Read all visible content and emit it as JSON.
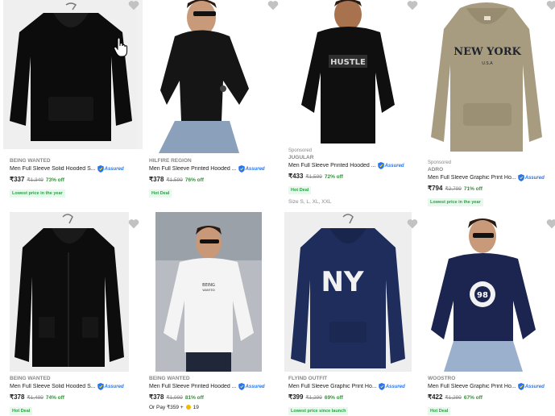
{
  "products": [
    {
      "brand": "BEING WANTED",
      "title": "Men Full Sleeve Solid Hooded S...",
      "price": "₹337",
      "mrp": "₹1,349",
      "off": "73% off",
      "badge": "Lowest price in the year",
      "assured": "Assured"
    },
    {
      "brand": "HILFIRE REGION",
      "title": "Men Full Sleeve Printed Hooded ...",
      "price": "₹378",
      "mrp": "₹1,599",
      "off": "76% off",
      "badge": "Hot Deal",
      "assured": "Assured"
    },
    {
      "sponsored": "Sponsored",
      "brand": "JUGULAR",
      "title": "Men Full Sleeve Printed Hooded ...",
      "price": "₹433",
      "mrp": "₹1,599",
      "off": "72% off",
      "badge": "Hot Deal",
      "sizes": "Size S, L, XL, XXL",
      "assured": "Assured",
      "print": "HUSTLE"
    },
    {
      "sponsored": "Sponsored",
      "brand": "ADRO",
      "title": "Men Full Sleeve Graphic Print Ho...",
      "price": "₹794",
      "mrp": "₹2,799",
      "off": "71% off",
      "badge": "Lowest price in the year",
      "assured": "Assured",
      "print": "NEW YORK",
      "print_sub": "U.S.A"
    },
    {
      "brand": "BEING WANTED",
      "title": "Men Full Sleeve Solid Hooded S...",
      "price": "₹378",
      "mrp": "₹1,499",
      "off": "74% off",
      "badge": "Hot Deal",
      "assured": "Assured"
    },
    {
      "brand": "BEING WANTED",
      "title": "Men Full Sleeve Printed Hooded ...",
      "price": "₹378",
      "mrp": "₹1,999",
      "off": "81% off",
      "orpay": "Or Pay ₹359 +",
      "coins": "19",
      "assured": "Assured",
      "print": "BEING",
      "print_sub": "WANTED"
    },
    {
      "brand": "FLYIND OUTFIT",
      "title": "Men Full Sleeve Graphic Print Ho...",
      "price": "₹399",
      "mrp": "₹1,299",
      "off": "69% off",
      "badge": "Lowest price since launch",
      "assured": "Assured",
      "print": "NY"
    },
    {
      "brand": "WOOSTRO",
      "title": "Men Full Sleeve Graphic Print Ho...",
      "price": "₹422",
      "mrp": "₹1,299",
      "off": "67% off",
      "badge": "Hot Deal",
      "assured": "Assured",
      "print": "98"
    }
  ],
  "colors": {
    "assured": "#2874f0",
    "discount": "#388e3c",
    "badge_text": "#26a541",
    "badge_bg": "#e7f8ec",
    "wishlist": "#c2c2c2"
  }
}
